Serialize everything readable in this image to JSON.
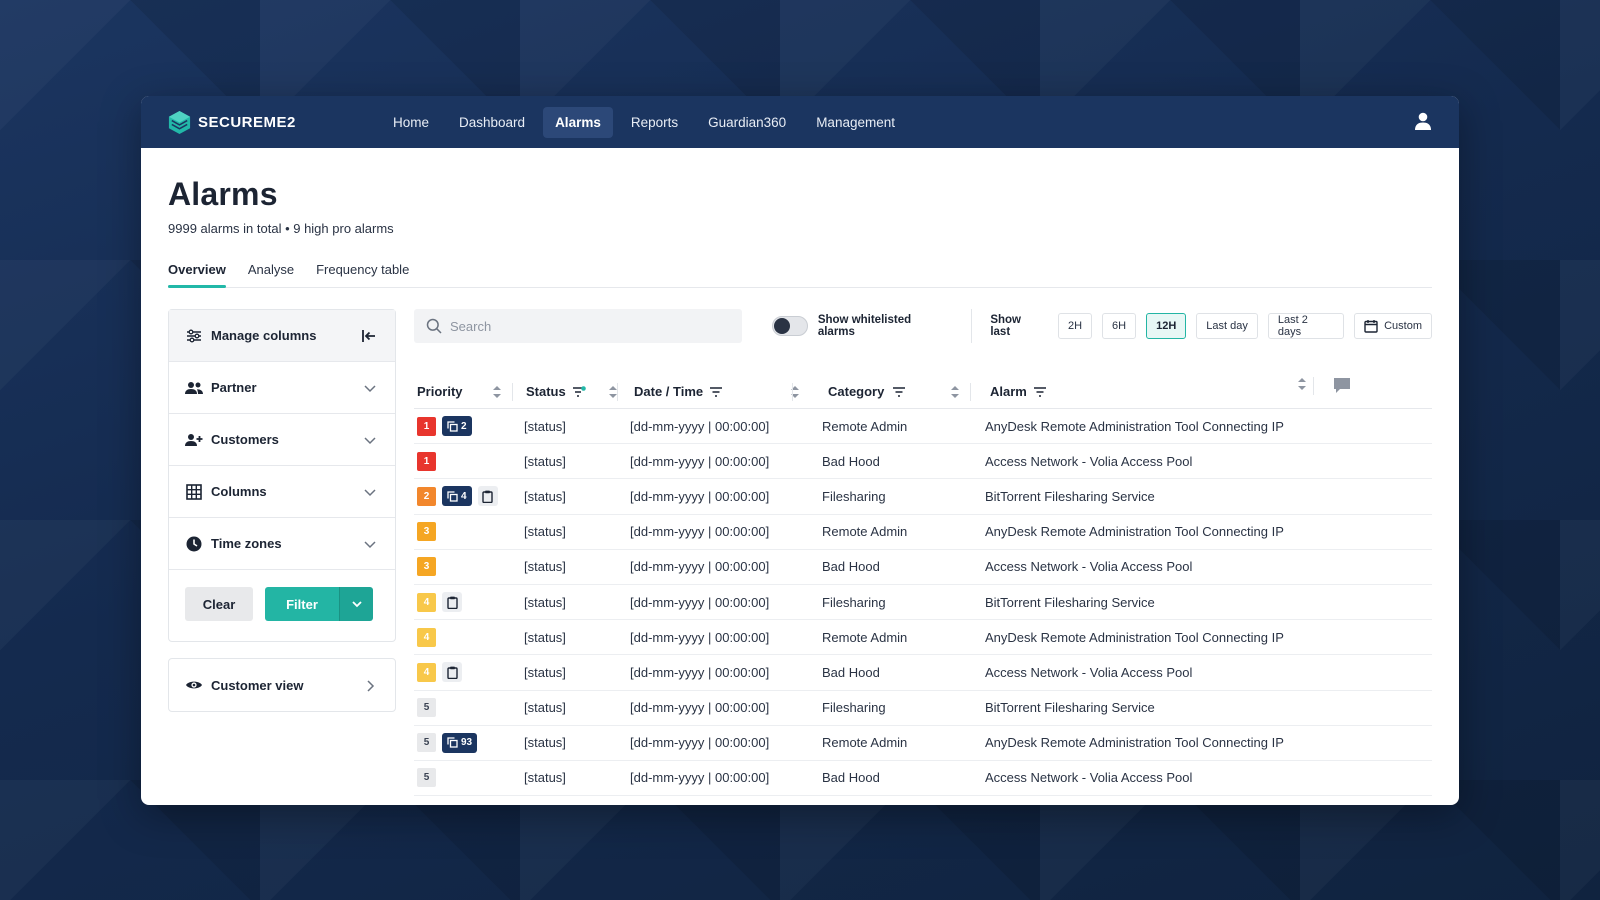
{
  "brand": {
    "name": "SECUREME2",
    "accent": "#22b8a8",
    "navy": "#1b3560"
  },
  "nav": {
    "items": [
      {
        "label": "Home",
        "active": false
      },
      {
        "label": "Dashboard",
        "active": false
      },
      {
        "label": "Alarms",
        "active": true
      },
      {
        "label": "Reports",
        "active": false
      },
      {
        "label": "Guardian360",
        "active": false
      },
      {
        "label": "Management",
        "active": false
      }
    ],
    "user_icon": "user-icon"
  },
  "page": {
    "title": "Alarms",
    "subtitle": "9999 alarms in total • 9 high pro alarms"
  },
  "tabs": [
    {
      "label": "Overview",
      "active": true
    },
    {
      "label": "Analyse",
      "active": false
    },
    {
      "label": "Frequency table",
      "active": false
    }
  ],
  "sidebar": {
    "header": "Manage columns",
    "sections": [
      {
        "label": "Partner",
        "icon": "users-icon"
      },
      {
        "label": "Customers",
        "icon": "user-plus-icon"
      },
      {
        "label": "Columns",
        "icon": "grid-icon"
      },
      {
        "label": "Time zones",
        "icon": "clock-icon"
      }
    ],
    "clear_label": "Clear",
    "filter_label": "Filter",
    "customer_view_label": "Customer view"
  },
  "toolbar": {
    "search_placeholder": "Search",
    "whitelist_label": "Show whitelisted alarms",
    "whitelist_on": false,
    "show_last_label": "Show last",
    "ranges": [
      {
        "label": "2H",
        "active": false
      },
      {
        "label": "6H",
        "active": false
      },
      {
        "label": "12H",
        "active": true
      },
      {
        "label": "Last day",
        "active": false
      },
      {
        "label": "Last 2 days",
        "active": false
      }
    ],
    "custom_label": "Custom"
  },
  "table": {
    "columns": {
      "priority": "Priority",
      "status": "Status",
      "datetime": "Date / Time",
      "category": "Category",
      "alarm": "Alarm"
    },
    "priority_colors": {
      "1": "#e8352d",
      "2": "#f2872c",
      "3": "#f5a623",
      "4": "#f8c84a",
      "5": "#e8e9eb"
    },
    "rows": [
      {
        "priority": "1",
        "duplicates": "2",
        "note": false,
        "status": "[status]",
        "datetime": "[dd-mm-yyyy | 00:00:00]",
        "category": "Remote Admin",
        "alarm": "AnyDesk Remote Administration Tool Connecting IP"
      },
      {
        "priority": "1",
        "duplicates": "",
        "note": false,
        "status": "[status]",
        "datetime": "[dd-mm-yyyy | 00:00:00]",
        "category": "Bad Hood",
        "alarm": "Access Network - Volia Access Pool"
      },
      {
        "priority": "2",
        "duplicates": "4",
        "note": true,
        "status": "[status]",
        "datetime": "[dd-mm-yyyy | 00:00:00]",
        "category": "Filesharing",
        "alarm": "BitTorrent Filesharing Service"
      },
      {
        "priority": "3",
        "duplicates": "",
        "note": false,
        "status": "[status]",
        "datetime": "[dd-mm-yyyy | 00:00:00]",
        "category": "Remote Admin",
        "alarm": "AnyDesk Remote Administration Tool Connecting IP"
      },
      {
        "priority": "3",
        "duplicates": "",
        "note": false,
        "status": "[status]",
        "datetime": "[dd-mm-yyyy | 00:00:00]",
        "category": "Bad Hood",
        "alarm": "Access Network - Volia Access Pool"
      },
      {
        "priority": "4",
        "duplicates": "",
        "note": true,
        "status": "[status]",
        "datetime": "[dd-mm-yyyy | 00:00:00]",
        "category": "Filesharing",
        "alarm": "BitTorrent Filesharing Service"
      },
      {
        "priority": "4",
        "duplicates": "",
        "note": false,
        "status": "[status]",
        "datetime": "[dd-mm-yyyy | 00:00:00]",
        "category": "Remote Admin",
        "alarm": "AnyDesk Remote Administration Tool Connecting IP"
      },
      {
        "priority": "4",
        "duplicates": "",
        "note": true,
        "status": "[status]",
        "datetime": "[dd-mm-yyyy | 00:00:00]",
        "category": "Bad Hood",
        "alarm": "Access Network - Volia Access Pool"
      },
      {
        "priority": "5",
        "duplicates": "",
        "note": false,
        "status": "[status]",
        "datetime": "[dd-mm-yyyy | 00:00:00]",
        "category": "Filesharing",
        "alarm": "BitTorrent Filesharing Service"
      },
      {
        "priority": "5",
        "duplicates": "93",
        "note": false,
        "status": "[status]",
        "datetime": "[dd-mm-yyyy | 00:00:00]",
        "category": "Remote Admin",
        "alarm": "AnyDesk Remote Administration Tool Connecting IP"
      },
      {
        "priority": "5",
        "duplicates": "",
        "note": false,
        "status": "[status]",
        "datetime": "[dd-mm-yyyy | 00:00:00]",
        "category": "Bad Hood",
        "alarm": "Access Network - Volia Access Pool"
      }
    ]
  }
}
